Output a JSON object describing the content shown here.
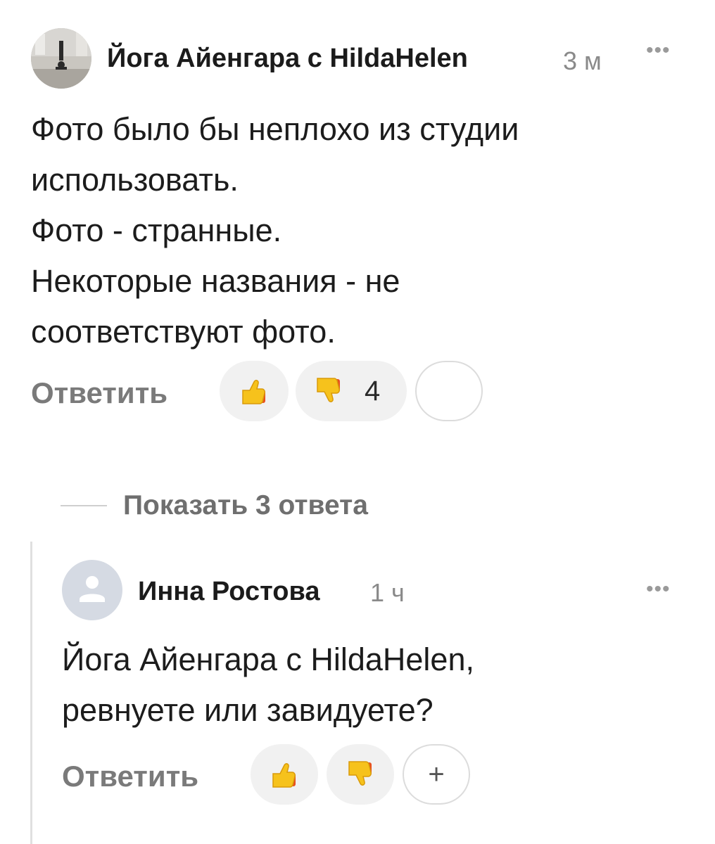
{
  "comment": {
    "author": "Йога Айенгара с HildaHelen",
    "time": "3 м",
    "more_icon": "more-dots-icon",
    "lines": [
      "Фото было бы неплохо из студии",
      "использовать.",
      "Фото - странные.",
      "Некоторые названия - не",
      "соответствуют фото."
    ],
    "reply_label": "Ответить",
    "like_icon": "thumbs-up-icon",
    "dislike_icon": "thumbs-down-icon",
    "dislike_count": "4"
  },
  "show_replies_label": "Показать 3 ответа",
  "reply": {
    "author": "Инна Ростова",
    "time": "1 ч",
    "lines": [
      "Йога Айенгара с HildaHelen,",
      "ревнуете или завидуете?"
    ],
    "reply_label": "Ответить",
    "add_reaction_symbol": "+"
  },
  "colors": {
    "thumb_yellow": "#f6c21c",
    "thumb_cuff": "#e8501e",
    "pill_bg": "#f1f1f1"
  }
}
